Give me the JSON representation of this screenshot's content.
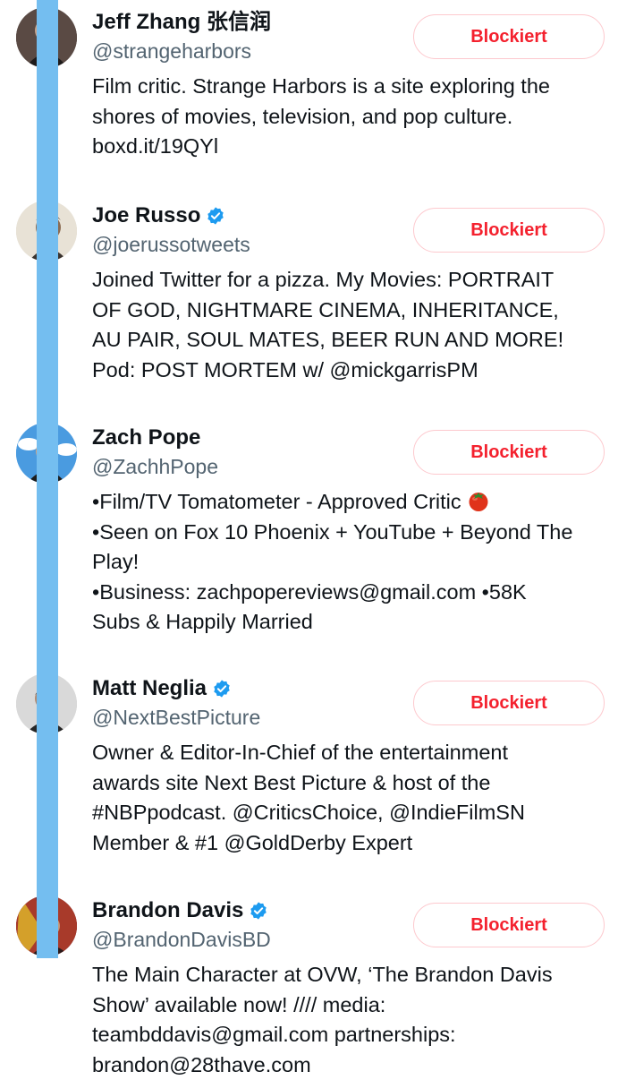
{
  "accounts": [
    {
      "name": "Jeff Zhang 张信润",
      "verified": false,
      "handle": "@strangeharbors",
      "button_label": "Blockiert",
      "bio_lines": [
        "Film critic. Strange Harbors is a site exploring the",
        "shores of movies, television, and pop culture.",
        "boxd.it/19QYl"
      ]
    },
    {
      "name": "Joe Russo",
      "verified": true,
      "handle": "@joerussotweets",
      "button_label": "Blockiert",
      "bio_lines": [
        "Joined Twitter for a pizza. My Movies: PORTRAIT",
        "OF GOD, NIGHTMARE CINEMA, INHERITANCE,",
        "AU PAIR, SOUL MATES, BEER RUN AND MORE!",
        "Pod: POST MORTEM w/ @mickgarrisPM"
      ]
    },
    {
      "name": "Zach Pope",
      "verified": false,
      "handle": "@ZachhPope",
      "button_label": "Blockiert",
      "bio_lines": [
        "•Film/TV Tomatometer - Approved Critic",
        "•Seen on Fox 10 Phoenix + YouTube + Beyond The",
        "Play!",
        "•Business: zachpopereviews@gmail.com •58K",
        "Subs & Happily Married"
      ]
    },
    {
      "name": "Matt Neglia",
      "verified": true,
      "handle": "@NextBestPicture",
      "button_label": "Blockiert",
      "bio_lines": [
        "Owner & Editor-In-Chief of the entertainment",
        "awards site Next Best Picture & host of the",
        "#NBPpodcast. @CriticsChoice, @IndieFilmSN",
        "Member & #1 @GoldDerby Expert"
      ]
    },
    {
      "name": "Brandon Davis",
      "verified": true,
      "handle": "@BrandonDavisBD",
      "button_label": "Blockiert",
      "bio_lines": [
        "The Main Character at OVW, ‘The Brandon Davis",
        "Show’ available now! //// media:",
        "teambddavis@gmail.com partnerships:",
        "brandon@28thave.com"
      ]
    }
  ],
  "colors": {
    "blocked_text": "#f4212e",
    "blocked_border": "#fdc9ce",
    "verified_badge": "#1d9bf0",
    "highlight_rail": "#74bef0",
    "handle_text": "#536471"
  }
}
